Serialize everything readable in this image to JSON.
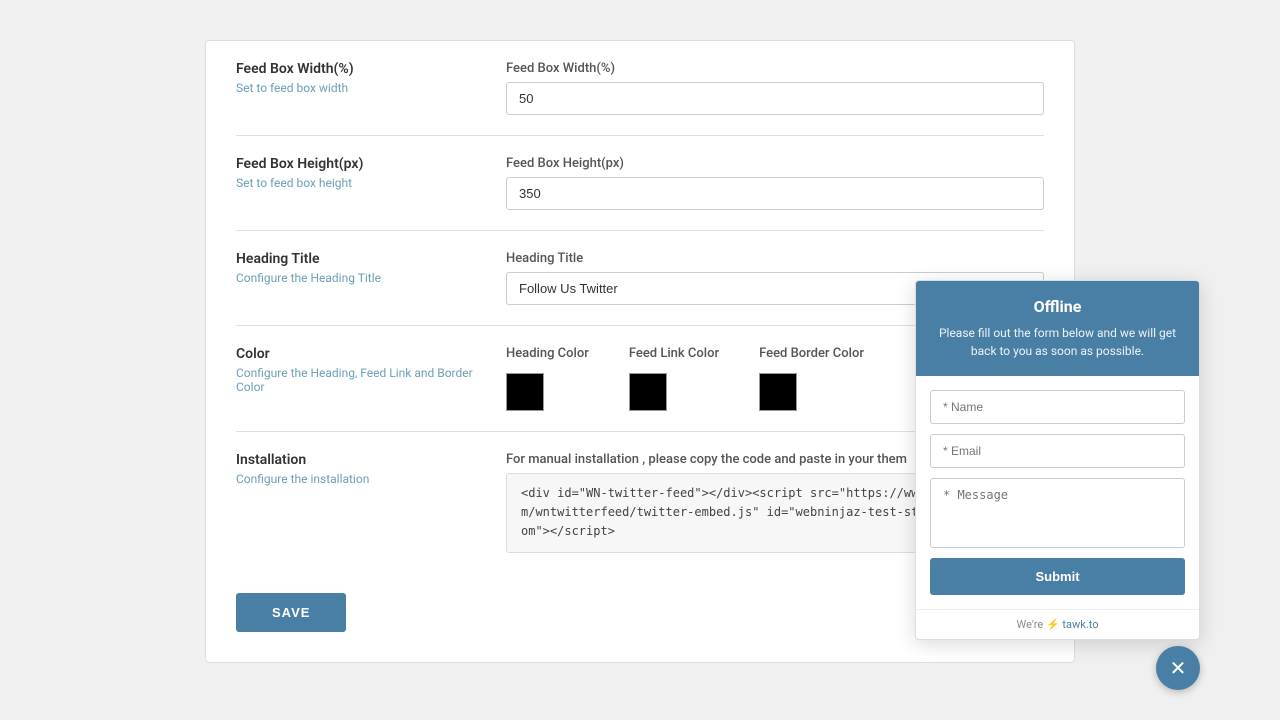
{
  "page": {
    "background": "#f0f0f0"
  },
  "form": {
    "sections": [
      {
        "id": "feed-box-width",
        "left_title": "Feed Box Width(%)",
        "left_desc": "Set to feed box width",
        "right_label": "Feed Box Width(%)",
        "right_value": "50",
        "right_placeholder": ""
      },
      {
        "id": "feed-box-height",
        "left_title": "Feed Box Height(px)",
        "left_desc": "Set to feed box height",
        "right_label": "Feed Box Height(px)",
        "right_value": "350",
        "right_placeholder": ""
      },
      {
        "id": "heading-title",
        "left_title": "Heading Title",
        "left_desc": "Configure the Heading Title",
        "right_label": "Heading Title",
        "right_value": "Follow Us Twitter",
        "right_placeholder": ""
      },
      {
        "id": "color",
        "left_title": "Color",
        "left_desc": "Configure the Heading, Feed Link and Border Color",
        "right_label": null,
        "colors": [
          {
            "label": "Heading Color",
            "value": "#000000"
          },
          {
            "label": "Feed Link Color",
            "value": "#000000"
          },
          {
            "label": "Feed Border Color",
            "value": "#000000"
          }
        ]
      },
      {
        "id": "installation",
        "left_title": "Installation",
        "left_desc": "Configure the installation",
        "right_label": "For manual installation , please copy the code and paste in your them",
        "right_code": "<div id=\"WN-twitter-feed\"></div><script src=\"https://www.webninjaz.com/wntwitterfeed/twitter-embed.js\" id=\"webninjaz-test-store.myshopify.com\"></script>"
      }
    ],
    "save_button_label": "SAVE"
  },
  "chat": {
    "status": "Offline",
    "description": "Please fill out the form below and we will get back to you as soon as possible.",
    "name_placeholder": "* Name",
    "email_placeholder": "* Email",
    "message_placeholder": "* Message",
    "submit_label": "Submit",
    "footer_text": "We're",
    "footer_brand": "tawk.to",
    "close_icon": "✕",
    "lightning_icon": "⚡"
  }
}
